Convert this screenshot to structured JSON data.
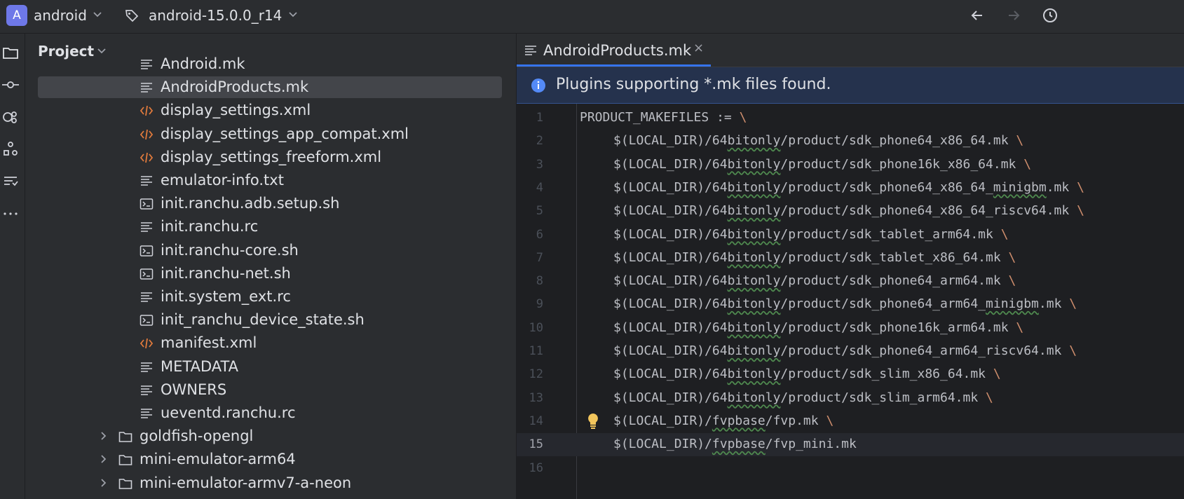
{
  "titlebar": {
    "project_initial": "A",
    "project_name": "android",
    "branch_name": "android-15.0.0_r14"
  },
  "project_panel": {
    "title": "Project",
    "items": [
      {
        "label": "Android.mk",
        "icon": "text-file-icon",
        "indent": 1
      },
      {
        "label": "AndroidProducts.mk",
        "icon": "text-file-icon",
        "indent": 1,
        "selected": true
      },
      {
        "label": "display_settings.xml",
        "icon": "xml-file-icon",
        "indent": 1
      },
      {
        "label": "display_settings_app_compat.xml",
        "icon": "xml-file-icon",
        "indent": 1
      },
      {
        "label": "display_settings_freeform.xml",
        "icon": "xml-file-icon",
        "indent": 1
      },
      {
        "label": "emulator-info.txt",
        "icon": "text-file-icon",
        "indent": 1
      },
      {
        "label": "init.ranchu.adb.setup.sh",
        "icon": "shell-file-icon",
        "indent": 1
      },
      {
        "label": "init.ranchu.rc",
        "icon": "text-file-icon",
        "indent": 1
      },
      {
        "label": "init.ranchu-core.sh",
        "icon": "shell-file-icon",
        "indent": 1
      },
      {
        "label": "init.ranchu-net.sh",
        "icon": "shell-file-icon",
        "indent": 1
      },
      {
        "label": "init.system_ext.rc",
        "icon": "text-file-icon",
        "indent": 1
      },
      {
        "label": "init_ranchu_device_state.sh",
        "icon": "shell-file-icon",
        "indent": 1
      },
      {
        "label": "manifest.xml",
        "icon": "xml-file-icon",
        "indent": 1
      },
      {
        "label": "METADATA",
        "icon": "text-file-icon",
        "indent": 1
      },
      {
        "label": "OWNERS",
        "icon": "text-file-icon",
        "indent": 1
      },
      {
        "label": "ueventd.ranchu.rc",
        "icon": "text-file-icon",
        "indent": 1
      },
      {
        "label": "goldfish-opengl",
        "icon": "folder-icon",
        "indent": 0
      },
      {
        "label": "mini-emulator-arm64",
        "icon": "folder-icon",
        "indent": 0
      },
      {
        "label": "mini-emulator-armv7-a-neon",
        "icon": "folder-icon",
        "indent": 0
      }
    ]
  },
  "editor": {
    "tab_label": "AndroidProducts.mk",
    "tab_close": "×",
    "banner_text": "Plugins supporting *.mk files found.",
    "current_line": 15,
    "lines": [
      {
        "n": "1",
        "pre": "PRODUCT_MAKEFILES := ",
        "w": "",
        "post": "",
        "bs": "\\",
        "indent": false
      },
      {
        "n": "2",
        "pre": "$(LOCAL_DIR)/64",
        "w": "bitonly",
        "post": "/product/sdk_phone64_x86_64.mk ",
        "bs": "\\",
        "indent": true
      },
      {
        "n": "3",
        "pre": "$(LOCAL_DIR)/64",
        "w": "bitonly",
        "post": "/product/sdk_phone16k_x86_64.mk ",
        "bs": "\\",
        "indent": true
      },
      {
        "n": "4",
        "pre": "$(LOCAL_DIR)/64",
        "w": "bitonly",
        "post": "/product/sdk_phone64_x86_64_",
        "w2": "minigbm",
        "post2": ".mk ",
        "bs": "\\",
        "indent": true
      },
      {
        "n": "5",
        "pre": "$(LOCAL_DIR)/64",
        "w": "bitonly",
        "post": "/product/sdk_phone64_x86_64_riscv64.mk ",
        "bs": "\\",
        "indent": true
      },
      {
        "n": "6",
        "pre": "$(LOCAL_DIR)/64",
        "w": "bitonly",
        "post": "/product/sdk_tablet_arm64.mk ",
        "bs": "\\",
        "indent": true
      },
      {
        "n": "7",
        "pre": "$(LOCAL_DIR)/64",
        "w": "bitonly",
        "post": "/product/sdk_tablet_x86_64.mk ",
        "bs": "\\",
        "indent": true
      },
      {
        "n": "8",
        "pre": "$(LOCAL_DIR)/64",
        "w": "bitonly",
        "post": "/product/sdk_phone64_arm64.mk ",
        "bs": "\\",
        "indent": true
      },
      {
        "n": "9",
        "pre": "$(LOCAL_DIR)/64",
        "w": "bitonly",
        "post": "/product/sdk_phone64_arm64_",
        "w2": "minigbm",
        "post2": ".mk ",
        "bs": "\\",
        "indent": true
      },
      {
        "n": "10",
        "pre": "$(LOCAL_DIR)/64",
        "w": "bitonly",
        "post": "/product/sdk_phone16k_arm64.mk ",
        "bs": "\\",
        "indent": true
      },
      {
        "n": "11",
        "pre": "$(LOCAL_DIR)/64",
        "w": "bitonly",
        "post": "/product/sdk_phone64_arm64_riscv64.mk ",
        "bs": "\\",
        "indent": true
      },
      {
        "n": "12",
        "pre": "$(LOCAL_DIR)/64",
        "w": "bitonly",
        "post": "/product/sdk_slim_x86_64.mk ",
        "bs": "\\",
        "indent": true
      },
      {
        "n": "13",
        "pre": "$(LOCAL_DIR)/64",
        "w": "bitonly",
        "post": "/product/sdk_slim_arm64.mk ",
        "bs": "\\",
        "indent": true
      },
      {
        "n": "14",
        "pre": "$(LOCAL_DIR)/",
        "w": "fvpbase",
        "post": "/fvp.mk ",
        "bs": "\\",
        "indent": true,
        "bulb": true
      },
      {
        "n": "15",
        "pre": "$(LOCAL_DIR)/",
        "w": "fvpbase",
        "post": "/fvp_mini.mk",
        "bs": "",
        "indent": true
      },
      {
        "n": "16",
        "pre": "",
        "w": "",
        "post": "",
        "bs": "",
        "indent": false
      }
    ]
  },
  "colors": {
    "accent": "#3574f0",
    "badge": "#6e78e8",
    "xml_icon": "#e07a3c",
    "backslash": "#cf8e6d"
  }
}
